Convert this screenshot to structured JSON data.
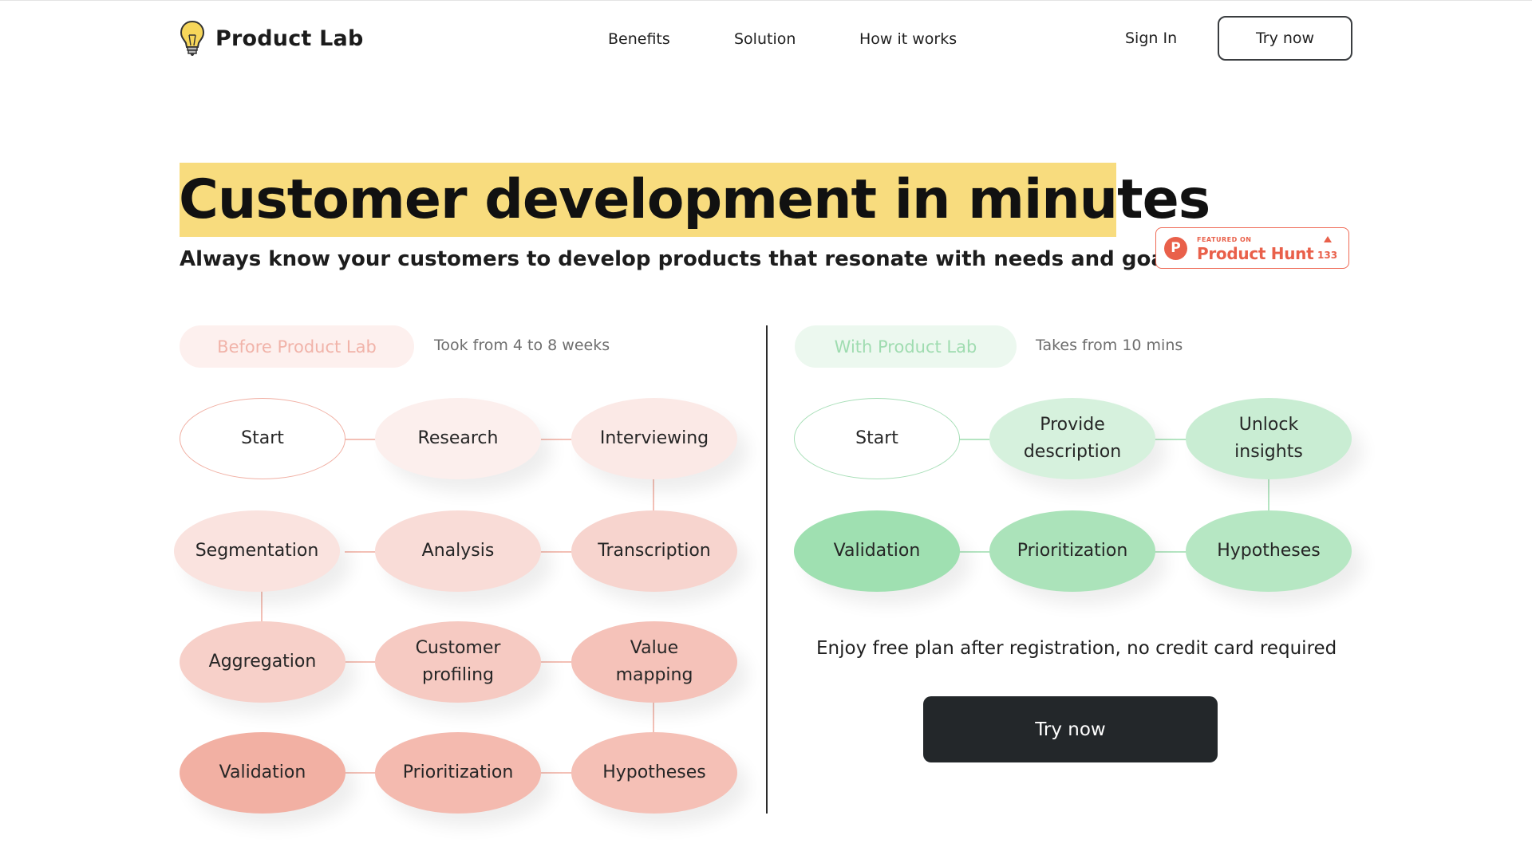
{
  "nav": {
    "logo_text": "Product Lab",
    "logo_icon": "lightbulb-icon",
    "links": [
      "Benefits",
      "Solution",
      "How it works"
    ],
    "sign_in": "Sign In",
    "try_now": "Try now"
  },
  "hero": {
    "title": "Customer development in minutes",
    "subtitle": "Always know your customers to develop products that resonate with needs and goals",
    "highlight_color": "#f8dc7e"
  },
  "product_hunt": {
    "featured": "FEATURED ON",
    "name": "Product Hunt",
    "count": "133",
    "color": "#e9604a"
  },
  "before": {
    "label": "Before Product Lab",
    "note": "Took from 4 to 8 weeks",
    "steps": [
      "Start",
      "Research",
      "Interviewing",
      "Segmentation",
      "Analysis",
      "Transcription",
      "Aggregation",
      "Customer profiling",
      "Value mapping",
      "Validation",
      "Prioritization",
      "Hypotheses"
    ]
  },
  "with": {
    "label": "With Product Lab",
    "note": "Takes from 10 mins",
    "steps": [
      "Start",
      "Provide description",
      "Unlock insights",
      "Validation",
      "Prioritization",
      "Hypotheses"
    ]
  },
  "cta": {
    "text": "Enjoy free plan after registration, no credit card required",
    "button": "Try now"
  }
}
